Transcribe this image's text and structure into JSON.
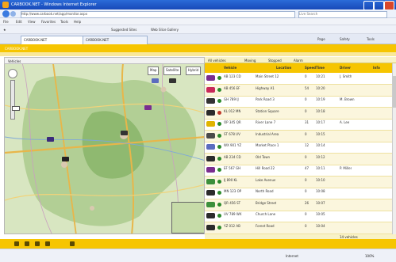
{
  "window": {
    "title": "CARBOOK.NET - Windows Internet Explorer"
  },
  "browser": {
    "url": "http://www.carbook.net/app/monitor.aspx",
    "search_placeholder": "Live Search",
    "menu": [
      "File",
      "Edit",
      "View",
      "Favorites",
      "Tools",
      "Help"
    ],
    "links": [
      "Suggested Sites",
      "Web Slice Gallery"
    ],
    "tabs": [
      "CARBOOK.NET",
      "CARBOOK.NET"
    ],
    "tools": [
      "Page",
      "Safety",
      "Tools"
    ]
  },
  "app": {
    "name": "CARBOOK.NET"
  },
  "map": {
    "types": [
      "Map",
      "Satellite",
      "Hybrid"
    ],
    "toolbar_label": "Vehicles"
  },
  "filters": [
    "All vehicles",
    "Moving",
    "Stopped",
    "Alarm"
  ],
  "table": {
    "headers": [
      "Vehicle",
      "Location",
      "Speed",
      "Time",
      "Driver",
      "Info"
    ],
    "rows": [
      {
        "color": "#7a2d8f",
        "status": "#2c8a2c",
        "vehicle": "AB 123 CD",
        "location": "Main Street 12",
        "speed": "0",
        "time": "10:21",
        "driver": "J. Smith",
        "info": ""
      },
      {
        "color": "#c8285a",
        "status": "#2c8a2c",
        "vehicle": "AB 456 EF",
        "location": "Highway A1",
        "speed": "54",
        "time": "10:20",
        "driver": "",
        "info": ""
      },
      {
        "color": "#333333",
        "status": "#2c8a2c",
        "vehicle": "GH 789 IJ",
        "location": "Park Road 3",
        "speed": "0",
        "time": "10:19",
        "driver": "M. Brown",
        "info": ""
      },
      {
        "color": "#2b2b2b",
        "status": "#c0392b",
        "vehicle": "KL 012 MN",
        "location": "Station Square",
        "speed": "0",
        "time": "10:18",
        "driver": "",
        "info": ""
      },
      {
        "color": "#e0b400",
        "status": "#2c8a2c",
        "vehicle": "OP 345 QR",
        "location": "River Lane 7",
        "speed": "31",
        "time": "10:17",
        "driver": "A. Lee",
        "info": ""
      },
      {
        "color": "#4a4a4a",
        "status": "#2c8a2c",
        "vehicle": "ST 678 UV",
        "location": "Industrial Area",
        "speed": "0",
        "time": "10:15",
        "driver": "",
        "info": ""
      },
      {
        "color": "#5b6cbf",
        "status": "#2c8a2c",
        "vehicle": "WX 901 YZ",
        "location": "Market Place 1",
        "speed": "12",
        "time": "10:14",
        "driver": "",
        "info": ""
      },
      {
        "color": "#2b2b2b",
        "status": "#2c8a2c",
        "vehicle": "AB 234 CD",
        "location": "Old Town",
        "speed": "0",
        "time": "10:12",
        "driver": "",
        "info": ""
      },
      {
        "color": "#7a2d8f",
        "status": "#2c8a2c",
        "vehicle": "EF 567 GH",
        "location": "Hill Road 22",
        "speed": "47",
        "time": "10:11",
        "driver": "P. Miller",
        "info": ""
      },
      {
        "color": "#3c8f3c",
        "status": "#2c8a2c",
        "vehicle": "IJ 890 KL",
        "location": "Lake Avenue",
        "speed": "0",
        "time": "10:10",
        "driver": "",
        "info": ""
      },
      {
        "color": "#2b2b2b",
        "status": "#2c8a2c",
        "vehicle": "MN 123 OP",
        "location": "North Road",
        "speed": "0",
        "time": "10:08",
        "driver": "",
        "info": ""
      },
      {
        "color": "#3c8f3c",
        "status": "#2c8a2c",
        "vehicle": "QR 456 ST",
        "location": "Bridge Street",
        "speed": "26",
        "time": "10:07",
        "driver": "",
        "info": ""
      },
      {
        "color": "#2b2b2b",
        "status": "#2c8a2c",
        "vehicle": "UV 789 WX",
        "location": "Church Lane",
        "speed": "0",
        "time": "10:05",
        "driver": "",
        "info": ""
      },
      {
        "color": "#2b2b2b",
        "status": "#2c8a2c",
        "vehicle": "YZ 012 AB",
        "location": "Forest Road",
        "speed": "0",
        "time": "10:04",
        "driver": "",
        "info": ""
      }
    ]
  },
  "footer": {
    "text": "14 vehicles"
  },
  "status": {
    "zone": "Internet",
    "zoom": "100%"
  }
}
